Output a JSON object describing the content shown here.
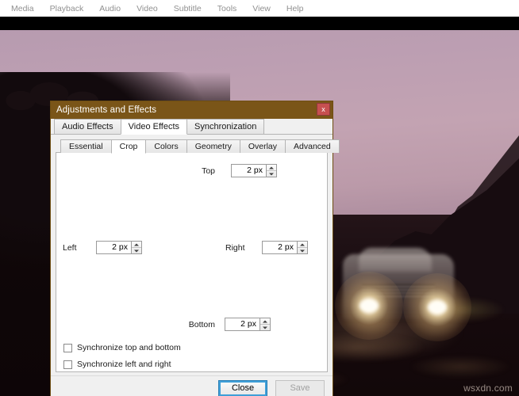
{
  "menubar": {
    "items": [
      {
        "label": "Media"
      },
      {
        "label": "Playback"
      },
      {
        "label": "Audio"
      },
      {
        "label": "Video"
      },
      {
        "label": "Subtitle"
      },
      {
        "label": "Tools"
      },
      {
        "label": "View"
      },
      {
        "label": "Help"
      }
    ]
  },
  "video": {
    "watermark": "wsxdn.com",
    "scene_description": "Car with headlights on dirt road at dusk"
  },
  "dialog": {
    "title": "Adjustments and Effects",
    "close_icon": "close-x-icon",
    "outer_tabs": [
      {
        "label": "Audio Effects",
        "active": false
      },
      {
        "label": "Video Effects",
        "active": true
      },
      {
        "label": "Synchronization",
        "active": false
      }
    ],
    "inner_tabs": [
      {
        "label": "Essential",
        "active": false
      },
      {
        "label": "Crop",
        "active": true
      },
      {
        "label": "Colors",
        "active": false
      },
      {
        "label": "Geometry",
        "active": false
      },
      {
        "label": "Overlay",
        "active": false
      },
      {
        "label": "Advanced",
        "active": false
      }
    ],
    "crop": {
      "top": {
        "label": "Top",
        "value": "2 px"
      },
      "left": {
        "label": "Left",
        "value": "2 px"
      },
      "right": {
        "label": "Right",
        "value": "2 px"
      },
      "bottom": {
        "label": "Bottom",
        "value": "2 px"
      },
      "checkboxes": [
        {
          "label": "Synchronize top and bottom",
          "checked": false
        },
        {
          "label": "Synchronize left and right",
          "checked": false
        }
      ]
    },
    "footer": {
      "close_label": "Close",
      "save_label": "Save"
    }
  },
  "colors": {
    "titlebar": "#7a5518",
    "close_button": "#c75050",
    "dialog_bg": "#f0f0f0",
    "focus_ring": "#3f9fd8",
    "sky": "#bd9fb2"
  }
}
